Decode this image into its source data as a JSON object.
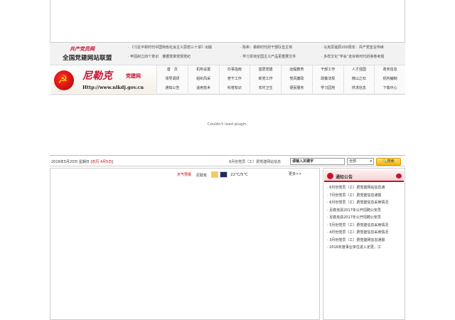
{
  "union": {
    "calligraphy": "共产党员网",
    "name": "全国党建网站联盟",
    "news": [
      "· 《习近平新时代中国特色社会主义思想三十讲》出版",
      "· 陈希：做新时代的干部队伍主将",
      "· 马克思诞辰200周年：共产党宣言传续",
      "· 牢固树立四个意识　遵循党章党规党纪",
      "· 学习贯彻全国主义产品更重要文件",
      "· 多样文化“学会”走好新时代的答卷考题"
    ]
  },
  "header": {
    "brand_name": "尼勒克",
    "brand_sub": "党建网",
    "url": "Http://www.nlkdj.gov.cn",
    "menu": [
      "首　页",
      "机构设置",
      "办事指南",
      "基层党建",
      "远程教育",
      "干部工作",
      "人才强国",
      "政务信息",
      "领导调研",
      "组织风采",
      "老干工作",
      "新党工作",
      "党风廉政",
      "政策法规",
      "微山之石",
      "机构编制",
      "通知公告",
      "适用技术",
      "科普知识",
      "农村卫生",
      "便民服务",
      "学习园地",
      "供求信息",
      "下载中心"
    ]
  },
  "plugin_message": "Couldn't load plugin.",
  "bar": {
    "date": "2016年5月20日 星期日",
    "lunar_link": "农历 4月5日",
    "scroll": "6月份党员（工）费党建网站信息",
    "search_placeholder": "请输入关键字",
    "select_value": "全部",
    "search_button": "搜索"
  },
  "weather": {
    "label": "天气预报",
    "city": "尼勒克",
    "temp": "22℃/5℃"
  },
  "more_link": "更多>>",
  "notice": {
    "title": "通知公告",
    "items": [
      "6月份党员（工）费党建网站信息通",
      "7月份党员（工）费党建信息通报",
      "6月份党员（工）费党建信息采用情况",
      "尼勒克县2017年公开招聘公安员",
      "尼勒克县2017年公开招聘公安员",
      "5月份党员（工）费党建信息采用情况",
      "4月份党员（工）费党建信息采用情况",
      "3月份党员（工）费党建网信息通报",
      "2016年度事业单位进入定更，江"
    ]
  }
}
